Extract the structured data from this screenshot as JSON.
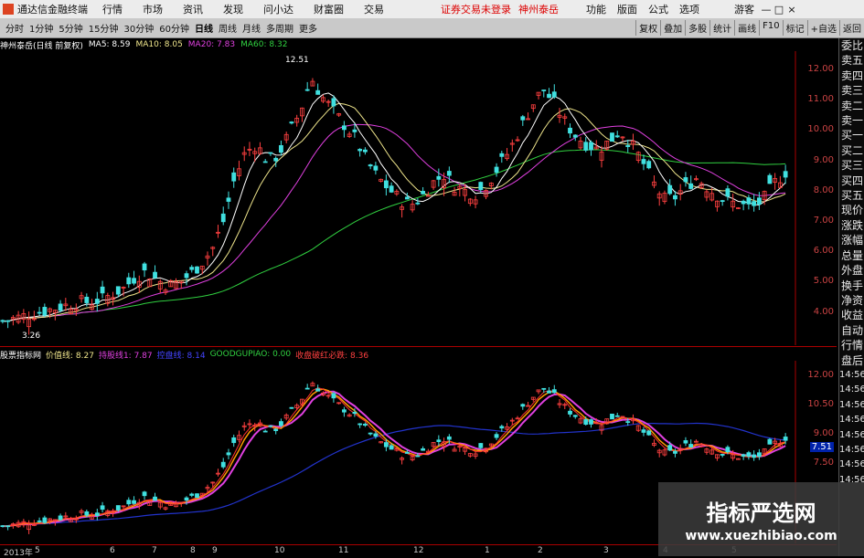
{
  "menubar": {
    "title": "通达信金融终端",
    "menus": [
      "行情",
      "市场",
      "资讯",
      "发现",
      "问小达",
      "财富圈",
      "交易"
    ],
    "warning": "证券交易未登录",
    "stock": "神州泰岳",
    "right_menus": [
      "功能",
      "版面",
      "公式",
      "选项"
    ],
    "guest": "游客",
    "window_buttons": [
      "—",
      "□",
      "×"
    ]
  },
  "toolbar": {
    "periods": [
      "分时",
      "1分钟",
      "5分钟",
      "15分钟",
      "30分钟",
      "60分钟",
      "日线",
      "周线",
      "月线",
      "多周期",
      "更多"
    ],
    "active_period": "日线",
    "right_items": [
      "复权",
      "叠加",
      "多股",
      "统计",
      "画线",
      "F10",
      "标记",
      "+自选",
      "返回"
    ]
  },
  "info": {
    "name": "神州泰岳(日线 前复权)",
    "ma5": "MA5: 8.59",
    "ma10": "MA10: 8.05",
    "ma20": "MA20: 7.83",
    "ma60": "MA60: 8.32"
  },
  "indicator": {
    "name": "股票指标网",
    "v1": "价值线: 8.27",
    "v2": "持股线1: 7.87",
    "v3": "控盘线: 8.14",
    "v4": "GOODGUPIAO: 0.00",
    "v5": "收盘破红必跌: 8.36"
  },
  "colors": {
    "up": "#ff4040",
    "down": "#40e0e0",
    "ma5": "#ffffff",
    "ma10": "#f0e68c",
    "ma20": "#e040e0",
    "ma60": "#30d040",
    "yaxis": "#cc4444"
  },
  "price_axis": [
    "12.00",
    "11.00",
    "10.00",
    "9.00",
    "8.00",
    "7.00",
    "6.00",
    "5.00",
    "4.00"
  ],
  "ind_axis": [
    "12.00",
    "10.50",
    "9.00",
    "7.50"
  ],
  "ind_current": "7.51",
  "high_label": "12.51",
  "low_label": "3.26",
  "x_axis": [
    "2013年",
    "5",
    "6",
    "7",
    "8",
    "9",
    "10",
    "11",
    "12",
    "1",
    "2",
    "3",
    "4",
    "5"
  ],
  "sidebar": [
    "委比",
    "卖五",
    "卖四",
    "卖三",
    "卖二",
    "卖一",
    "买一",
    "买二",
    "买三",
    "买四",
    "买五",
    "现价",
    "涨跌",
    "涨幅",
    "总量",
    "外盘",
    "换手",
    "净资",
    "收益",
    "自动",
    "行情",
    "盘后",
    "14:56",
    "14:56",
    "14:56",
    "14:56",
    "14:56",
    "14:56",
    "14:56",
    "14:56"
  ],
  "watermark": {
    "line1": "指标严选网",
    "line2": "www.xuezhibiao.com"
  }
}
